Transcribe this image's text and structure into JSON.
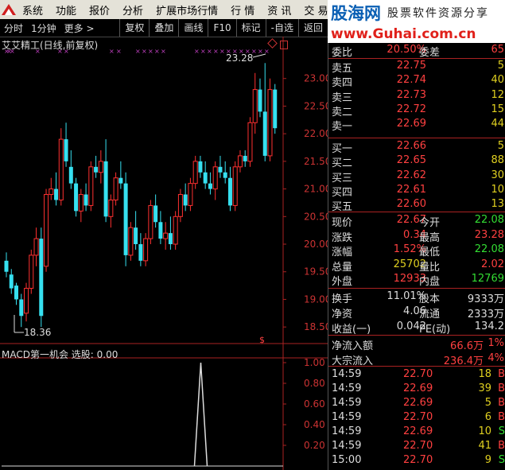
{
  "menubar": {
    "items": [
      "系统",
      "功能",
      "报价",
      "分析",
      "扩展市场行情",
      "行 情",
      "资 讯",
      "交 易"
    ]
  },
  "tabbar": {
    "left": [
      "分时",
      "1分钟",
      "更多 >"
    ],
    "buttons": [
      "复权",
      "叠加",
      "画线",
      "F10",
      "标记",
      "-自选",
      "返回"
    ]
  },
  "chart": {
    "title": "艾艾精工(日线,前复权)",
    "high_label": "23.28",
    "low_label": "18.36",
    "y_ticks": [
      "23.00",
      "22.50",
      "22.00",
      "21.50",
      "21.00",
      "20.50",
      "20.00",
      "19.50",
      "19.00",
      "18.50"
    ],
    "s_marker": "$",
    "colors": {
      "up": "#ff3030",
      "down": "#36e0f0",
      "axis": "#cc2222"
    }
  },
  "chart_data": {
    "type": "candlestick",
    "y_range": [
      18.2,
      23.5
    ],
    "candles": [
      [
        19.7,
        19.85,
        19.4,
        19.5
      ],
      [
        19.45,
        19.55,
        19.1,
        19.2
      ],
      [
        19.25,
        19.3,
        18.9,
        19.0
      ],
      [
        19.0,
        19.1,
        18.5,
        18.7
      ],
      [
        18.75,
        19.3,
        18.6,
        19.2
      ],
      [
        19.2,
        19.9,
        19.1,
        19.8
      ],
      [
        19.8,
        20.3,
        19.6,
        20.1
      ],
      [
        20.1,
        20.3,
        18.5,
        18.7
      ],
      [
        19.6,
        21.0,
        19.5,
        20.9
      ],
      [
        20.9,
        21.2,
        20.8,
        21.0
      ],
      [
        21.0,
        21.3,
        20.7,
        20.8
      ],
      [
        20.8,
        22.1,
        20.7,
        21.9
      ],
      [
        21.9,
        22.2,
        21.4,
        21.5
      ],
      [
        21.4,
        21.7,
        21.0,
        21.1
      ],
      [
        21.1,
        21.2,
        20.5,
        20.6
      ],
      [
        20.6,
        21.0,
        20.4,
        20.9
      ],
      [
        20.9,
        21.1,
        20.6,
        20.7
      ],
      [
        20.7,
        21.5,
        20.6,
        21.4
      ],
      [
        21.4,
        21.6,
        21.2,
        21.3
      ],
      [
        21.3,
        21.7,
        21.1,
        21.5
      ],
      [
        21.5,
        21.9,
        20.4,
        20.5
      ],
      [
        20.5,
        20.9,
        20.3,
        20.8
      ],
      [
        20.8,
        21.3,
        20.7,
        21.2
      ],
      [
        21.2,
        21.5,
        21.0,
        21.1
      ],
      [
        21.1,
        21.3,
        19.6,
        19.8
      ],
      [
        19.8,
        20.4,
        19.7,
        20.3
      ],
      [
        20.3,
        20.6,
        19.9,
        20.0
      ],
      [
        20.0,
        20.2,
        19.6,
        19.7
      ],
      [
        19.7,
        20.2,
        19.6,
        20.1
      ],
      [
        20.1,
        20.8,
        20.0,
        20.7
      ],
      [
        20.7,
        20.9,
        20.3,
        20.4
      ],
      [
        20.4,
        20.6,
        20.0,
        20.1
      ],
      [
        20.1,
        20.4,
        19.9,
        20.2
      ],
      [
        20.2,
        20.5,
        19.9,
        20.0
      ],
      [
        20.0,
        20.6,
        19.9,
        20.5
      ],
      [
        20.5,
        21.0,
        20.4,
        20.9
      ],
      [
        20.9,
        21.1,
        20.6,
        20.7
      ],
      [
        20.7,
        21.2,
        20.6,
        21.1
      ],
      [
        21.1,
        21.6,
        21.0,
        21.5
      ],
      [
        21.5,
        21.6,
        21.2,
        21.3
      ],
      [
        21.3,
        21.5,
        21.0,
        21.1
      ],
      [
        21.1,
        21.3,
        20.9,
        21.0
      ],
      [
        21.0,
        21.5,
        20.8,
        21.4
      ],
      [
        21.4,
        21.6,
        21.2,
        21.3
      ],
      [
        21.3,
        21.5,
        21.1,
        21.2
      ],
      [
        21.2,
        21.4,
        20.6,
        20.7
      ],
      [
        20.7,
        21.5,
        20.6,
        21.4
      ],
      [
        21.4,
        21.7,
        21.3,
        21.6
      ],
      [
        21.6,
        21.7,
        21.4,
        21.5
      ],
      [
        21.5,
        22.3,
        21.4,
        22.2
      ],
      [
        22.2,
        23.1,
        22.0,
        22.8
      ],
      [
        22.8,
        23.0,
        22.3,
        22.4
      ],
      [
        22.4,
        23.28,
        21.5,
        21.6
      ],
      [
        21.6,
        23.0,
        21.5,
        22.8
      ],
      [
        22.8,
        22.9,
        22.0,
        22.1
      ]
    ],
    "macd_title": "MACD第一机会 选股: 0.00",
    "macd_y_ticks": [
      "1.00",
      "0.80",
      "0.60",
      "0.40",
      "0.20"
    ],
    "macd_signal_position": 0.58
  },
  "quote": {
    "weibi_label": "委比",
    "weibi_value": "20.50%",
    "weicha_label": "委差",
    "weicha_value": "65",
    "sell": [
      {
        "label": "卖五",
        "price": "22.75",
        "vol": "5"
      },
      {
        "label": "卖四",
        "price": "22.74",
        "vol": "40"
      },
      {
        "label": "卖三",
        "price": "22.73",
        "vol": "12"
      },
      {
        "label": "卖二",
        "price": "22.72",
        "vol": "15"
      },
      {
        "label": "卖一",
        "price": "22.69",
        "vol": "44"
      }
    ],
    "buy": [
      {
        "label": "买一",
        "price": "22.66",
        "vol": "5"
      },
      {
        "label": "买二",
        "price": "22.65",
        "vol": "88"
      },
      {
        "label": "买三",
        "price": "22.62",
        "vol": "30"
      },
      {
        "label": "买四",
        "price": "22.61",
        "vol": "10"
      },
      {
        "label": "买五",
        "price": "22.60",
        "vol": "13"
      }
    ],
    "stats": [
      {
        "l1": "现价",
        "v1": "22.67",
        "c1": "red",
        "l2": "今开",
        "v2": "22.08",
        "c2": "green"
      },
      {
        "l1": "涨跌",
        "v1": "0.34",
        "c1": "red",
        "l2": "最高",
        "v2": "23.28",
        "c2": "red"
      },
      {
        "l1": "涨幅",
        "v1": "1.52%",
        "c1": "red",
        "l2": "最低",
        "v2": "22.08",
        "c2": "green"
      },
      {
        "l1": "总量",
        "v1": "25702",
        "c1": "yellow",
        "l2": "量比",
        "v2": "2.02",
        "c2": "red"
      },
      {
        "l1": "外盘",
        "v1": "12933",
        "c1": "red",
        "l2": "内盘",
        "v2": "12769",
        "c2": "green"
      }
    ],
    "stats2": [
      {
        "l1": "换手",
        "v1": "11.01%",
        "c1": "white",
        "l2": "股本",
        "v2": "9333万",
        "c2": "white"
      },
      {
        "l1": "净资",
        "v1": "4.06",
        "c1": "white",
        "l2": "流通",
        "v2": "2333万",
        "c2": "white"
      },
      {
        "l1": "收益(一)",
        "v1": "0.042",
        "c1": "white",
        "l2": "PE(动)",
        "v2": "134.2",
        "c2": "white"
      }
    ],
    "flow": [
      {
        "l": "净流入额",
        "v": "66.6万",
        "p": "1%"
      },
      {
        "l": "大宗流入",
        "v": "236.4万",
        "p": "4%"
      }
    ],
    "ticks": [
      {
        "t": "14:59",
        "p": "22.70",
        "q": "18",
        "bs": "B",
        "c": "red"
      },
      {
        "t": "14:59",
        "p": "22.69",
        "q": "39",
        "bs": "B",
        "c": "red"
      },
      {
        "t": "14:59",
        "p": "22.69",
        "q": "5",
        "bs": "B",
        "c": "red"
      },
      {
        "t": "14:59",
        "p": "22.70",
        "q": "6",
        "bs": "B",
        "c": "red"
      },
      {
        "t": "14:59",
        "p": "22.69",
        "q": "10",
        "bs": "S",
        "c": "green"
      },
      {
        "t": "14:59",
        "p": "22.70",
        "q": "41",
        "bs": "B",
        "c": "red"
      },
      {
        "t": "15:00",
        "p": "22.70",
        "q": "9",
        "bs": "S",
        "c": "green"
      }
    ]
  },
  "ad": {
    "logo": "股海网",
    "slogan": "股票软件资源分享",
    "url": "www.Guhai.com.cn"
  }
}
